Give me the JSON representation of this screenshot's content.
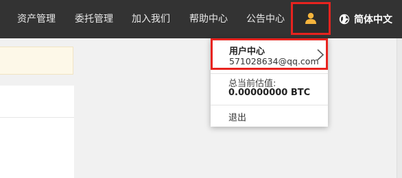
{
  "nav": {
    "items": [
      {
        "label": "资产管理"
      },
      {
        "label": "委托管理"
      },
      {
        "label": "加入我们"
      },
      {
        "label": "帮助中心"
      },
      {
        "label": "公告中心"
      }
    ],
    "user_icon": "user-icon",
    "language": "简体中文",
    "language_icon": "globe-icon"
  },
  "dropdown": {
    "title": "用户中心",
    "email": "571028634@qq.com",
    "estimate_label": "总当前估值:",
    "estimate_value": "0.00000000 BTC",
    "logout": "退出"
  },
  "colors": {
    "topbar": "#333333",
    "highlight": "#e8231f",
    "user_icon": "#f5b43c"
  }
}
